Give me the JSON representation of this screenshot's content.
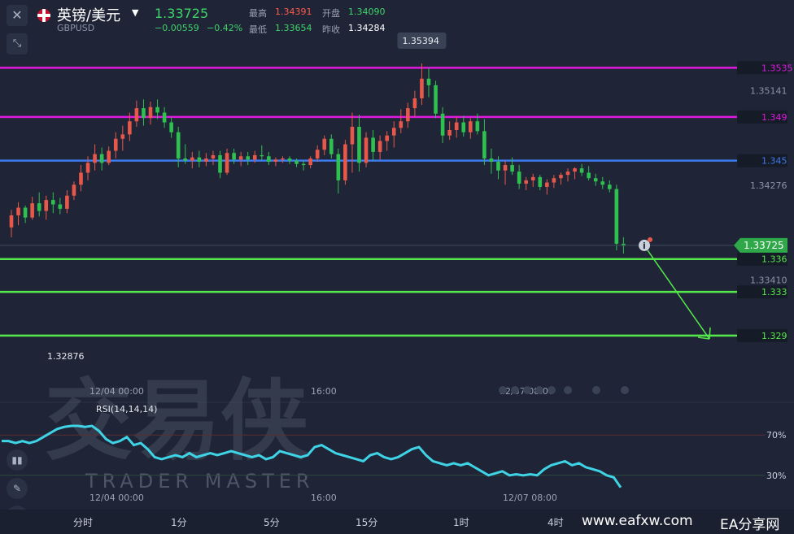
{
  "header": {
    "title": "英镑/美元",
    "symbol": "GBPUSD",
    "price": "1.33725",
    "change": "−0.00559",
    "change_pct": "−0.42%",
    "high_label": "最高",
    "high_value": "1.34391",
    "open_label": "开盘",
    "open_value": "1.34090",
    "low_label": "最低",
    "low_value": "1.33654",
    "prev_label": "昨收",
    "prev_value": "1.34284"
  },
  "timeframes": [
    "分时",
    "1分",
    "5分",
    "15分",
    "1时",
    "4时"
  ],
  "watermark": {
    "brand": "交易侠",
    "brand_en": "TRADER MASTER",
    "site": "www.eafxw.com",
    "site2": "EA分享网"
  },
  "colors": {
    "background": "#1f2536",
    "up": "#e8584a",
    "down": "#2fc14f",
    "rsi": "#3fd3e6",
    "magenta": "#e018e0",
    "blue": "#3d7bf0",
    "green_level": "#55e84a",
    "price_tag": "#2fa84a"
  },
  "chart_data": {
    "type": "candlestick",
    "symbol": "GBPUSD",
    "y_range": [
      1.3255,
      1.3562
    ],
    "price_axis_labels": [
      "1.35141",
      "1.34276",
      "1.33410"
    ],
    "time_labels_main": [
      "12/04 00:00",
      "16:00",
      "12/07 08:00"
    ],
    "time_labels_rsi": [
      "12/04 00:00",
      "16:00",
      "12/07 08:00"
    ],
    "high_marker": "1.35394",
    "low_marker": "1.32876",
    "current_price": "1.33725",
    "levels": [
      {
        "value": 1.3535,
        "label": "1.3535",
        "color": "magenta"
      },
      {
        "value": 1.349,
        "label": "1.349",
        "color": "magenta"
      },
      {
        "value": 1.345,
        "label": "1.345",
        "color": "blue"
      },
      {
        "value": 1.336,
        "label": "1.336",
        "color": "green"
      },
      {
        "value": 1.333,
        "label": "1.333",
        "color": "green"
      },
      {
        "value": 1.329,
        "label": "1.329",
        "color": "green"
      }
    ],
    "candles": [
      [
        1.3389,
        1.3405,
        1.338,
        1.34
      ],
      [
        1.34,
        1.3412,
        1.3391,
        1.3407
      ],
      [
        1.3407,
        1.3409,
        1.3393,
        1.3398
      ],
      [
        1.3398,
        1.3417,
        1.3396,
        1.3411
      ],
      [
        1.3411,
        1.3421,
        1.3399,
        1.3404
      ],
      [
        1.3404,
        1.3418,
        1.3396,
        1.3414
      ],
      [
        1.3414,
        1.3421,
        1.3402,
        1.341
      ],
      [
        1.341,
        1.3416,
        1.3401,
        1.3406
      ],
      [
        1.3406,
        1.3423,
        1.3402,
        1.3418
      ],
      [
        1.3418,
        1.3431,
        1.3414,
        1.3428
      ],
      [
        1.3428,
        1.3446,
        1.3422,
        1.3439
      ],
      [
        1.3439,
        1.3454,
        1.3432,
        1.3448
      ],
      [
        1.3448,
        1.3465,
        1.3441,
        1.3456
      ],
      [
        1.3456,
        1.3462,
        1.3441,
        1.3448
      ],
      [
        1.3448,
        1.3463,
        1.3446,
        1.3459
      ],
      [
        1.3459,
        1.3476,
        1.3452,
        1.347
      ],
      [
        1.347,
        1.3482,
        1.3459,
        1.3474
      ],
      [
        1.3474,
        1.3494,
        1.3468,
        1.3486
      ],
      [
        1.3486,
        1.3505,
        1.3481,
        1.3498
      ],
      [
        1.3498,
        1.3506,
        1.3482,
        1.3489
      ],
      [
        1.3489,
        1.3504,
        1.3483,
        1.3499
      ],
      [
        1.3499,
        1.3506,
        1.3488,
        1.3494
      ],
      [
        1.3494,
        1.3499,
        1.348,
        1.3485
      ],
      [
        1.3485,
        1.349,
        1.3471,
        1.3476
      ],
      [
        1.3476,
        1.3481,
        1.3444,
        1.3452
      ],
      [
        1.3452,
        1.3465,
        1.3447,
        1.345
      ],
      [
        1.345,
        1.3458,
        1.3443,
        1.3453
      ],
      [
        1.3453,
        1.3459,
        1.3444,
        1.3449
      ],
      [
        1.3449,
        1.3457,
        1.3445,
        1.3452
      ],
      [
        1.3452,
        1.3459,
        1.3446,
        1.3455
      ],
      [
        1.3455,
        1.3459,
        1.3434,
        1.3439
      ],
      [
        1.3439,
        1.3461,
        1.3437,
        1.3457
      ],
      [
        1.3457,
        1.3461,
        1.3447,
        1.3451
      ],
      [
        1.3451,
        1.3458,
        1.3445,
        1.3454
      ],
      [
        1.3454,
        1.3458,
        1.3446,
        1.3451
      ],
      [
        1.3451,
        1.3459,
        1.3448,
        1.3455
      ],
      [
        1.3455,
        1.3464,
        1.345,
        1.3454
      ],
      [
        1.3454,
        1.3458,
        1.3446,
        1.3449
      ],
      [
        1.3449,
        1.3453,
        1.3445,
        1.3451
      ],
      [
        1.3451,
        1.3454,
        1.3448,
        1.3452
      ],
      [
        1.3452,
        1.3454,
        1.3447,
        1.345
      ],
      [
        1.345,
        1.3452,
        1.3444,
        1.3447
      ],
      [
        1.3447,
        1.345,
        1.3441,
        1.3446
      ],
      [
        1.3446,
        1.3454,
        1.3443,
        1.3452
      ],
      [
        1.3452,
        1.3464,
        1.3449,
        1.346
      ],
      [
        1.346,
        1.3473,
        1.3455,
        1.347
      ],
      [
        1.347,
        1.3474,
        1.3452,
        1.3456
      ],
      [
        1.3456,
        1.3461,
        1.342,
        1.3432
      ],
      [
        1.3432,
        1.3469,
        1.3428,
        1.3465
      ],
      [
        1.3465,
        1.3494,
        1.3439,
        1.3481
      ],
      [
        1.3481,
        1.3492,
        1.344,
        1.3448
      ],
      [
        1.3448,
        1.3476,
        1.3444,
        1.3471
      ],
      [
        1.3471,
        1.3478,
        1.345,
        1.3458
      ],
      [
        1.3458,
        1.3473,
        1.3451,
        1.3468
      ],
      [
        1.3468,
        1.3477,
        1.3459,
        1.3473
      ],
      [
        1.3473,
        1.3486,
        1.3462,
        1.348
      ],
      [
        1.348,
        1.3497,
        1.3475,
        1.3486
      ],
      [
        1.3486,
        1.3503,
        1.348,
        1.3498
      ],
      [
        1.3498,
        1.3514,
        1.349,
        1.3507
      ],
      [
        1.3507,
        1.3539,
        1.3501,
        1.3525
      ],
      [
        1.3525,
        1.3535,
        1.3508,
        1.3519
      ],
      [
        1.3519,
        1.3523,
        1.3489,
        1.3493
      ],
      [
        1.3493,
        1.3499,
        1.3466,
        1.3473
      ],
      [
        1.3473,
        1.3486,
        1.3469,
        1.3478
      ],
      [
        1.3478,
        1.349,
        1.3471,
        1.3485
      ],
      [
        1.3485,
        1.3491,
        1.3472,
        1.3476
      ],
      [
        1.3476,
        1.3489,
        1.347,
        1.3486
      ],
      [
        1.3486,
        1.3493,
        1.3474,
        1.3477
      ],
      [
        1.3477,
        1.3488,
        1.3446,
        1.3452
      ],
      [
        1.3452,
        1.3461,
        1.3438,
        1.3449
      ],
      [
        1.3449,
        1.3454,
        1.3433,
        1.3441
      ],
      [
        1.3441,
        1.345,
        1.3428,
        1.3446
      ],
      [
        1.3446,
        1.3453,
        1.3437,
        1.344
      ],
      [
        1.344,
        1.3446,
        1.3424,
        1.3429
      ],
      [
        1.3429,
        1.3435,
        1.3423,
        1.3432
      ],
      [
        1.3432,
        1.3438,
        1.3426,
        1.3435
      ],
      [
        1.3435,
        1.3437,
        1.3423,
        1.3426
      ],
      [
        1.3426,
        1.3433,
        1.3419,
        1.343
      ],
      [
        1.343,
        1.3437,
        1.3425,
        1.3434
      ],
      [
        1.3434,
        1.3439,
        1.3428,
        1.3437
      ],
      [
        1.3437,
        1.3443,
        1.3431,
        1.344
      ],
      [
        1.344,
        1.3444,
        1.3433,
        1.3443
      ],
      [
        1.3443,
        1.3447,
        1.3436,
        1.3439
      ],
      [
        1.3439,
        1.3445,
        1.3432,
        1.3434
      ],
      [
        1.3434,
        1.3438,
        1.3427,
        1.3431
      ],
      [
        1.3431,
        1.3435,
        1.3424,
        1.3428
      ],
      [
        1.3428,
        1.3432,
        1.3421,
        1.3424
      ],
      [
        1.3424,
        1.3428,
        1.3368,
        1.3374
      ],
      [
        1.3374,
        1.338,
        1.3365,
        1.3372
      ]
    ],
    "rsi": {
      "label": "RSI(14,14,14)",
      "levels": [
        70,
        30
      ],
      "values": [
        64,
        64,
        62,
        64,
        62,
        64,
        68,
        72,
        76,
        78,
        79,
        79,
        78,
        79,
        74,
        66,
        62,
        64,
        68,
        60,
        62,
        56,
        48,
        46,
        48,
        50,
        48,
        52,
        48,
        50,
        52,
        50,
        52,
        54,
        52,
        50,
        48,
        50,
        46,
        48,
        54,
        52,
        50,
        48,
        50,
        58,
        60,
        56,
        52,
        50,
        48,
        46,
        44,
        50,
        52,
        48,
        46,
        48,
        52,
        56,
        58,
        50,
        44,
        42,
        40,
        42,
        40,
        42,
        38,
        34,
        30,
        32,
        34,
        30,
        31,
        30,
        31,
        30,
        36,
        40,
        42,
        44,
        40,
        42,
        38,
        36,
        34,
        30,
        28,
        18
      ]
    }
  }
}
